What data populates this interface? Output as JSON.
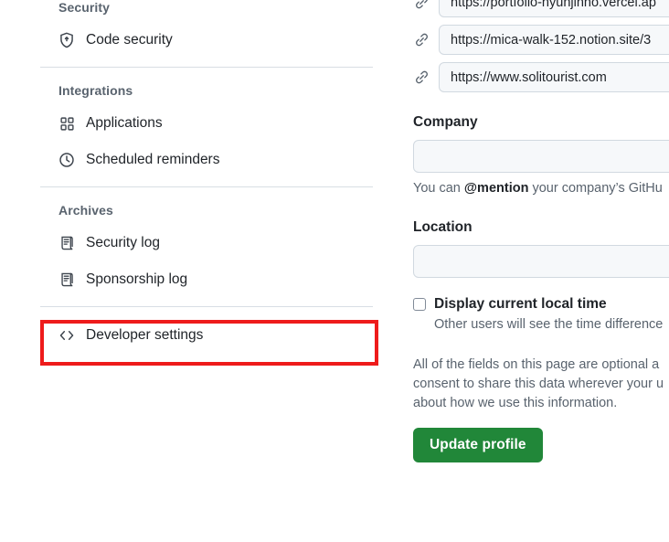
{
  "sidebar": {
    "sections": [
      {
        "heading": "Security",
        "items": [
          {
            "label": "Code security",
            "icon": "shield-icon"
          }
        ]
      },
      {
        "heading": "Integrations",
        "items": [
          {
            "label": "Applications",
            "icon": "grid-icon"
          },
          {
            "label": "Scheduled reminders",
            "icon": "clock-icon"
          }
        ]
      },
      {
        "heading": "Archives",
        "items": [
          {
            "label": "Security log",
            "icon": "log-icon"
          },
          {
            "label": "Sponsorship log",
            "icon": "log-icon"
          }
        ]
      }
    ],
    "developer_settings": {
      "label": "Developer settings",
      "icon": "code-icon"
    }
  },
  "highlight": {
    "color": "#ee1b1b",
    "target": "Developer settings"
  },
  "profile": {
    "urls": [
      {
        "icon": "link-icon",
        "value": "https://portfolio-hyunjinno.vercel.ap"
      },
      {
        "icon": "link-icon",
        "value": "https://mica-walk-152.notion.site/3"
      },
      {
        "icon": "link-icon",
        "value": "https://www.solitourist.com"
      }
    ],
    "company": {
      "label": "Company",
      "value": "",
      "placeholder": "",
      "hint_prefix": "You can ",
      "hint_mention": "@mention",
      "hint_suffix": " your company’s GitHu"
    },
    "location": {
      "label": "Location",
      "value": "",
      "placeholder": ""
    },
    "local_time": {
      "label": "Display current local time",
      "sublabel": "Other users will see the time difference",
      "checked": false
    },
    "disclaimer": [
      "All of the fields on this page are optional a",
      "consent to share this data wherever your u",
      "about how we use this information."
    ],
    "submit_label": "Update profile",
    "accent_color": "#218739"
  }
}
